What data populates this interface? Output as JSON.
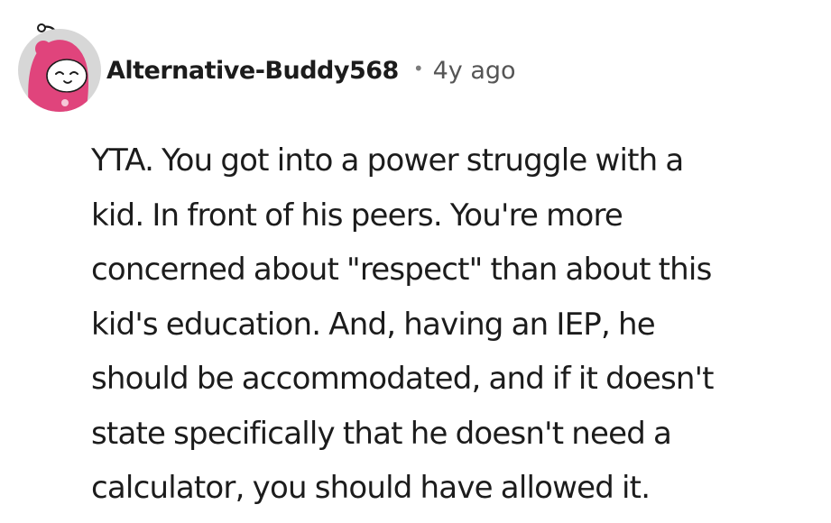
{
  "comment": {
    "author": "Alternative-Buddy568",
    "separator": "•",
    "timestamp": "4y ago",
    "avatar_icon": "snoo-avatar-icon",
    "body_lines": [
      "YTA. You got into a power struggle with a",
      "kid. In front of his peers. You're more",
      "concerned about \"respect\" than about this",
      "kid's education. And, having an IEP, he",
      "should be accommodated, and if it doesn't",
      "state specifically that he doesn't need a",
      "calculator, you should have allowed it."
    ]
  },
  "colors": {
    "text": "#1c1c1c",
    "meta": "#555555",
    "avatar_bg": "#d4d4d4",
    "avatar_hood": "#e0447c"
  }
}
